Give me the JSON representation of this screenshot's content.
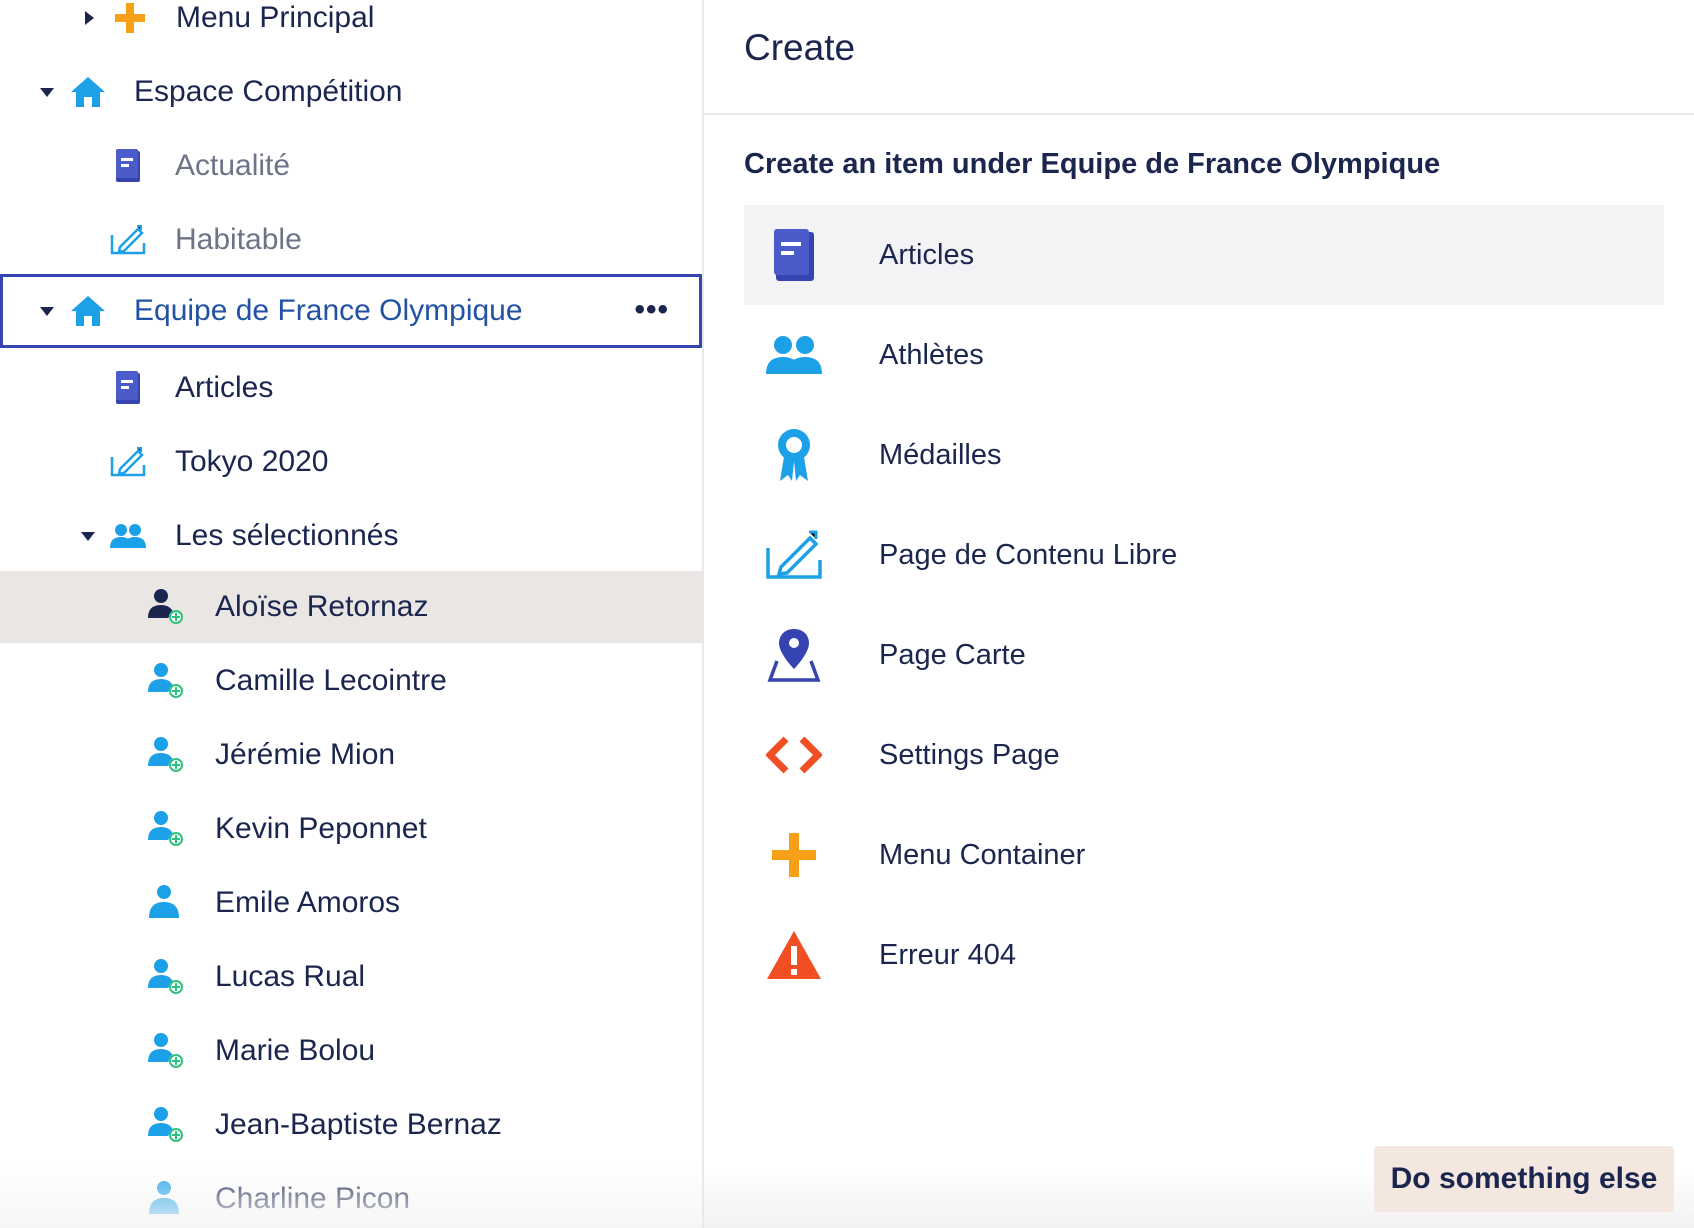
{
  "colors": {
    "navy": "#1b264f",
    "link_blue": "#2152a3",
    "sky": "#1ca0e8",
    "indigo": "#3544b1",
    "orange": "#f5a016",
    "red_orange": "#f24e24",
    "green": "#2bc37c",
    "hover_bg": "#e9e6e4"
  },
  "tree": {
    "nodes": [
      {
        "label": "Menu Principal",
        "icon": "plus-icon",
        "caret": "right"
      },
      {
        "label": "Espace Compétition",
        "icon": "home-icon",
        "caret": "down"
      },
      {
        "label": "Actualité",
        "icon": "book-icon",
        "caret": "none"
      },
      {
        "label": "Habitable",
        "icon": "edit-page-icon",
        "caret": "none"
      },
      {
        "label": "Equipe de France Olympique",
        "icon": "home-icon",
        "caret": "down",
        "actions": "•••"
      },
      {
        "label": "Articles",
        "icon": "book-icon",
        "caret": "none"
      },
      {
        "label": "Tokyo 2020",
        "icon": "edit-page-icon",
        "caret": "none"
      },
      {
        "label": "Les sélectionnés",
        "icon": "users-icon",
        "caret": "down"
      },
      {
        "label": "Aloïse Retornaz",
        "icon": "user-add-icon",
        "caret": "none"
      },
      {
        "label": "Camille Lecointre",
        "icon": "user-add-icon",
        "caret": "none"
      },
      {
        "label": "Jérémie Mion",
        "icon": "user-add-icon",
        "caret": "none"
      },
      {
        "label": "Kevin Peponnet",
        "icon": "user-add-icon",
        "caret": "none"
      },
      {
        "label": "Emile Amoros",
        "icon": "user-icon",
        "caret": "none"
      },
      {
        "label": "Lucas Rual",
        "icon": "user-add-icon",
        "caret": "none"
      },
      {
        "label": "Marie Bolou",
        "icon": "user-add-icon",
        "caret": "none"
      },
      {
        "label": "Jean-Baptiste Bernaz",
        "icon": "user-add-icon",
        "caret": "none"
      },
      {
        "label": "Charline Picon",
        "icon": "user-icon",
        "caret": "none"
      }
    ]
  },
  "create": {
    "title": "Create",
    "subtitle": "Create an item under Equipe de France Olympique",
    "items": [
      {
        "label": "Articles",
        "icon": "book-icon"
      },
      {
        "label": "Athlètes",
        "icon": "users-icon"
      },
      {
        "label": "Médailles",
        "icon": "medal-icon"
      },
      {
        "label": "Page de Contenu Libre",
        "icon": "edit-page-icon"
      },
      {
        "label": "Page Carte",
        "icon": "map-pin-icon"
      },
      {
        "label": "Settings Page",
        "icon": "code-icon"
      },
      {
        "label": "Menu Container",
        "icon": "plus-icon"
      },
      {
        "label": "Erreur 404",
        "icon": "warning-icon"
      }
    ],
    "action_button": "Do something else"
  }
}
